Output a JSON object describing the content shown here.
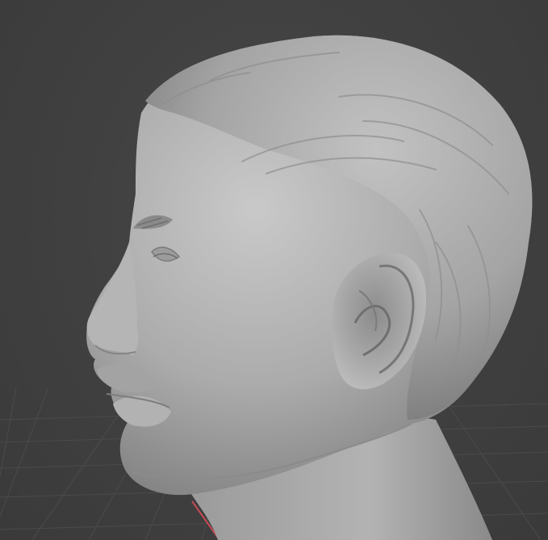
{
  "viewport": {
    "mode": "3d-sculpt-view",
    "background_color": "#3f3f3f",
    "grid_color": "#4c4c4c",
    "model_color": "#a9a9a9",
    "axis_x_color": "#c64b54"
  },
  "model": {
    "subject": "human-head-bust",
    "orientation": "left-profile",
    "shading": "matcap-gray"
  }
}
